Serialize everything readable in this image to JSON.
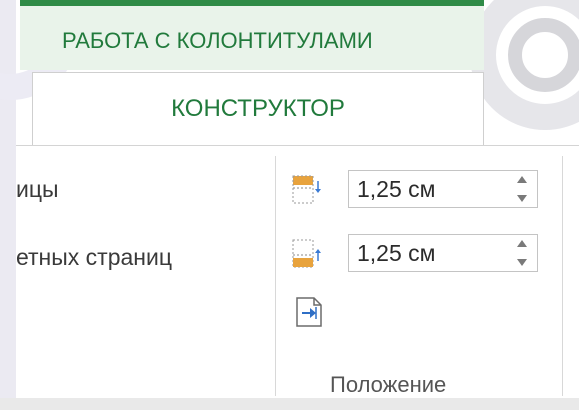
{
  "context_tab": {
    "title": "РАБОТА С КОЛОНТИТУЛАМИ"
  },
  "active_tab": {
    "label": "КОНСТРУКТОР"
  },
  "options": {
    "first": "ицы",
    "second": "етных страниц"
  },
  "position_group": {
    "header_offset": {
      "value": "1,25 см",
      "icon": "header-from-top-icon"
    },
    "footer_offset": {
      "value": "1,25 см",
      "icon": "footer-from-bottom-icon"
    },
    "insert_alignment_tab_icon": "insert-alignment-tab-icon",
    "label": "Положение"
  },
  "colors": {
    "accent_green": "#217a3c",
    "context_bg": "#e9f3ea",
    "icon_orange": "#e8a33d"
  }
}
